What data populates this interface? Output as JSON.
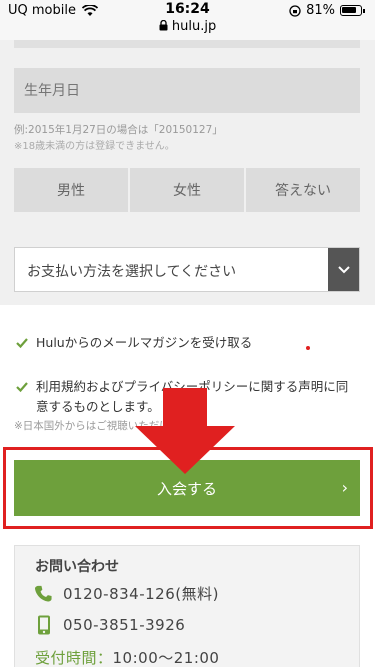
{
  "status_bar": {
    "carrier": "UQ mobile",
    "time": "16:24",
    "url": "hulu.jp",
    "battery": "81%"
  },
  "form": {
    "birthday_placeholder": "生年月日",
    "birthday_hint": "例:2015年1月27日の場合は「20150127」",
    "age_notice": "※18歳未満の方は登録できません。",
    "gender_options": [
      "男性",
      "女性",
      "答えない"
    ],
    "payment_placeholder": "お支払い方法を選択してください"
  },
  "agreements": {
    "newsletter": "Huluからのメールマガジンを受け取る",
    "terms_line1": "利用規約およびプライバシーポリシーに関する声明に同",
    "terms_line2": "意するものとします。",
    "overseas_notice": "※日本国外からはご視聴いただけません。"
  },
  "join_button": {
    "label": "入会する",
    "chevron": "›"
  },
  "contact": {
    "title": "お問い合わせ",
    "phone_free": "0120-834-126(無料)",
    "phone_mobile": "050-3851-3926",
    "hours_label": "受付時間：",
    "hours_value": "10:00〜21:00"
  },
  "colors": {
    "accent_green": "#6ea03c",
    "annotation_red": "#e02020"
  },
  "icons": {
    "wifi": "wifi-icon",
    "lock": "lock-icon",
    "rotation_lock": "rotation-lock-icon",
    "battery": "battery-icon",
    "select_arrow": "chevron-down-icon",
    "checkbox": "check-icon",
    "phone": "phone-icon",
    "mobile": "mobile-phone-icon"
  }
}
